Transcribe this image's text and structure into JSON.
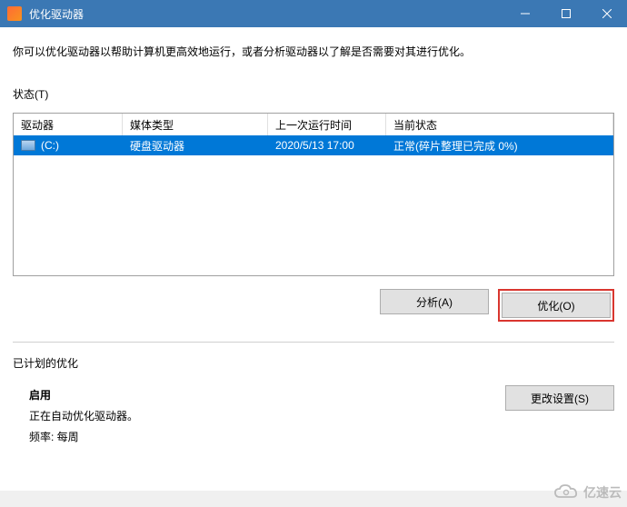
{
  "titlebar": {
    "title": "优化驱动器"
  },
  "description": "你可以优化驱动器以帮助计算机更高效地运行，或者分析驱动器以了解是否需要对其进行优化。",
  "status_label": "状态(T)",
  "table": {
    "headers": {
      "drive": "驱动器",
      "media": "媒体类型",
      "last": "上一次运行时间",
      "state": "当前状态"
    },
    "rows": [
      {
        "drive": "(C:)",
        "media": "硬盘驱动器",
        "last": "2020/5/13 17:00",
        "state": "正常(碎片整理已完成 0%)"
      }
    ]
  },
  "buttons": {
    "analyze": "分析(A)",
    "optimize": "优化(O)",
    "change_settings": "更改设置(S)"
  },
  "schedule": {
    "section_label": "已计划的优化",
    "on_label": "启用",
    "desc": "正在自动优化驱动器。",
    "freq": "频率: 每周"
  },
  "watermark": "亿速云"
}
